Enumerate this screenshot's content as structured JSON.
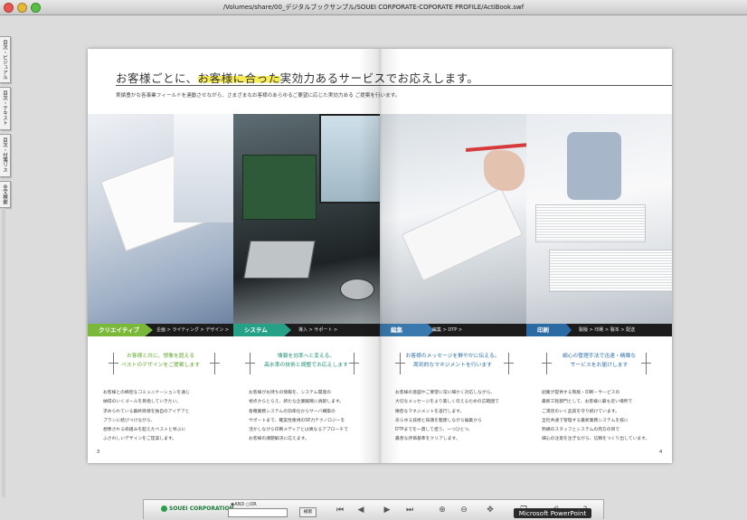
{
  "window": {
    "title": "/Volumes/share/00_デジタルブックサンプル/SOUEI CORPORATE-COPORATE PROFILE/ActiBook.swf"
  },
  "side_tabs": [
    "目次・ビジュアル",
    "目次・テキスト",
    "目次・付箋リスト",
    "全文検索"
  ],
  "spread": {
    "headline_pre": "お客様ごとに、",
    "headline_highlight": "お客様に合った",
    "headline_post": "実効力あるサービスでお応えします。",
    "subline": "実績豊かな各事業フィールドを連動させながら、さまざまなお客様のあらゆるご要望に応じた実効力ある ご提案を行います。",
    "sections": [
      {
        "tag": "クリエイティブ",
        "flow": "企画 > ライティング > デザイン >",
        "catch": [
          "お客様と共に、想像を超える",
          "ベストのデザインをご提案します"
        ],
        "body": [
          "お客様との綿密なコミュニケーションを通じ",
          "納得のいくゴールを目指していきたい。",
          "求められている最終目標を独自のアイデアと",
          "プランに結びつけながら、",
          "想像される枠組みを超えたベストと呼ぶに",
          "ふさわしいデザインをご提案します。"
        ]
      },
      {
        "tag": "システム",
        "flow": "導入 > サポート >",
        "catch": [
          "情報を効率へと変える。",
          "高水準の技術と調整でお応えします"
        ],
        "body": [
          "お客様がお持ちの情報を、システム開発の",
          "視点からとらえ、新たな企業戦略に貢献します。",
          "各種業務システムの効率化からサーバ構築の",
          "サポートまで、確実性重視のSE力テクノロジーを",
          "活かしながら印刷メディアとは異なるアプローチで",
          "お客様の課題解決に応えます。"
        ]
      },
      {
        "tag": "編集",
        "flow": "編集 > DTP >",
        "catch": [
          "お客様のメッセージを鮮やかに伝える。",
          "周到的なマネジメントを行います"
        ],
        "body": [
          "お客様の意図やご要望に常に細かく対応しながら、",
          "大切なメッセージをより美しく伝えるための広範囲で",
          "緻密なマネジメントを遂行します。",
          "あらゆる技術と知識を駆使しながら編集から",
          "DTPまでを一貫して担う、一つひとつ、",
          "最善な評価基準をクリアします。"
        ]
      },
      {
        "tag": "印刷",
        "flow": "製版 > 印刷 > 製本 > 配送",
        "catch": [
          "細心の管理手法で迅速・精緻な",
          "サービスをお届けします"
        ],
        "body": [
          "創業が提供する製版・印刷・サービスの",
          "最新工程部門として、お客様に最も近い場所で",
          "ご満足のいく品質を守り続けています。",
          "全社共通で管理する最新業務システムを核に",
          "熟練のスタッフとシステムの両方の目で",
          "細心の注意を注ぎながら、信頼をつくり出しています。"
        ]
      }
    ],
    "page_left": "3",
    "page_right": "4"
  },
  "toolbar": {
    "logo_text": "SOUEI CORPORATION",
    "radio_and": "AND",
    "radio_or": "OR",
    "search_button": "検索",
    "icons": [
      "first-page-icon",
      "prev-page-icon",
      "next-page-icon",
      "last-page-icon",
      "zoom-in-icon",
      "zoom-out-icon",
      "move-icon",
      "print-icon",
      "help-icon"
    ]
  },
  "overlay_label": "Microsoft PowerPoint",
  "colors": {
    "creative": "#7ab83a",
    "system": "#27a088",
    "edit": "#3a79ad",
    "print": "#2c6aa4",
    "highlight": "#f6ec56"
  }
}
